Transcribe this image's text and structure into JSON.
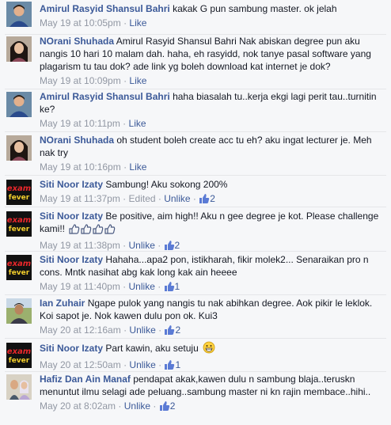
{
  "comments": [
    {
      "author": "Amirul Rasyid Shansul Bahri",
      "text": "kakak G pun sambung master. ok jelah",
      "time": "May 19 at 10:05pm",
      "actions": [
        "Like"
      ],
      "avatar": "boy-avatar-blue-shirt"
    },
    {
      "author": "NOrani Shuhada",
      "text": "Amirul Rasyid Shansul Bahri Nak abiskan degree pun aku nangis 10 hari 10 malam dah. haha, eh rasyidd, nok tanye pasal software yang plagarism tu tau dok? ade link yg boleh download kat internet je dok?",
      "time": "May 19 at 10:09pm",
      "actions": [
        "Like"
      ],
      "avatar": "girl-avatar-dark-hair"
    },
    {
      "author": "Amirul Rasyid Shansul Bahri",
      "text": "haha biasalah tu..kerja ekgi lagi perit tau..turnitin ke?",
      "time": "May 19 at 10:11pm",
      "actions": [
        "Like"
      ],
      "avatar": "boy-avatar-blue-shirt"
    },
    {
      "author": "NOrani Shuhada",
      "text": "oh student boleh create acc tu eh? aku ingat lecturer je. Meh nak try",
      "time": "May 19 at 10:16pm",
      "actions": [
        "Like"
      ],
      "avatar": "girl-avatar-dark-hair"
    },
    {
      "author": "Siti Noor Izaty",
      "text": "Sambung! Aku sokong 200%",
      "time": "May 19 at 11:37pm",
      "edited": "Edited",
      "actions": [
        "Unlike"
      ],
      "likes": "2",
      "avatar": "exam-fever-logo"
    },
    {
      "author": "Siti Noor Izaty",
      "text": "Be positive, aim high!! Aku n gee degree je kot. Please challenge kami!!",
      "time": "May 19 at 11:38pm",
      "actions": [
        "Unlike"
      ],
      "likes": "2",
      "avatar": "exam-fever-logo",
      "emoticons": [
        "thumbs-up-emoticon",
        "thumbs-up-emoticon",
        "thumbs-up-emoticon",
        "thumbs-up-emoticon"
      ]
    },
    {
      "author": "Siti Noor Izaty",
      "text": "Hahaha...apa2 pon, istikharah, fikir molek2... Senaraikan pro n cons. Mntk nasihat abg kak long kak ain heeee",
      "time": "May 19 at 11:40pm",
      "actions": [
        "Unlike"
      ],
      "likes": "1",
      "avatar": "exam-fever-logo"
    },
    {
      "author": "Ian Zuhair",
      "text": "Ngape pulok yang nangis tu nak abihkan degree. Aok pikir le leklok. Koi sapot je. Nok kawen dulu pon ok. Kui3",
      "time": "May 20 at 12:16am",
      "actions": [
        "Unlike"
      ],
      "likes": "2",
      "avatar": "man-avatar-outdoor"
    },
    {
      "author": "Siti Noor Izaty",
      "text": "Part kawin, aku setuju",
      "time": "May 20 at 12:50am",
      "actions": [
        "Unlike"
      ],
      "likes": "1",
      "avatar": "exam-fever-logo",
      "emoticons": [
        "grin-emoticon"
      ]
    },
    {
      "author": "Hafiz Dan Ain Manaf",
      "text": "pendapat akak,kawen dulu n sambung blaja..teruskn menuntut ilmu selagi ade peluang..sambung master ni kn rajin membace..hihi..",
      "time": "May 20 at 8:02am",
      "actions": [
        "Unlike"
      ],
      "likes": "2",
      "avatar": "couple-avatar"
    }
  ],
  "colors": {
    "link": "#3b5998",
    "text": "#141823",
    "meta": "#9197a3",
    "bg": "#f6f7f9"
  }
}
